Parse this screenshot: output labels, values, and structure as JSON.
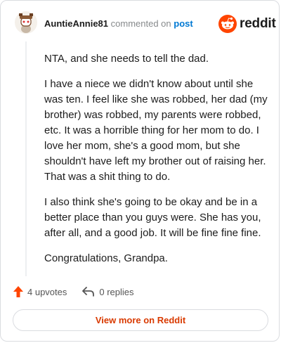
{
  "header": {
    "username": "AuntieAnnie81",
    "action_text": "commented on",
    "post_link": "post"
  },
  "brand": {
    "name": "reddit",
    "icon": "reddit-alien-icon",
    "color": "#ff4500"
  },
  "comment": {
    "paragraphs": [
      "NTA, and she needs to tell the dad.",
      "I have a niece we didn't know about until she was ten. I feel like she was robbed, her dad (my brother) was robbed, my parents were robbed, etc. It was a horrible thing for her mom to do. I love her mom, she's a good mom, but she shouldn't have left my brother out of raising her. That was a shit thing to do.",
      "I also think she's going to be okay and be in a better place than you guys were. She has you, after all, and a good job. It will be fine fine fine.",
      "Congratulations, Grandpa."
    ]
  },
  "footer": {
    "upvotes_label": "4 upvotes",
    "upvote_icon": "upvote-arrow-icon",
    "replies_label": "0 replies",
    "reply_icon": "reply-arrow-icon"
  },
  "view_more": {
    "label": "View more on Reddit",
    "color": "#d93a00"
  }
}
